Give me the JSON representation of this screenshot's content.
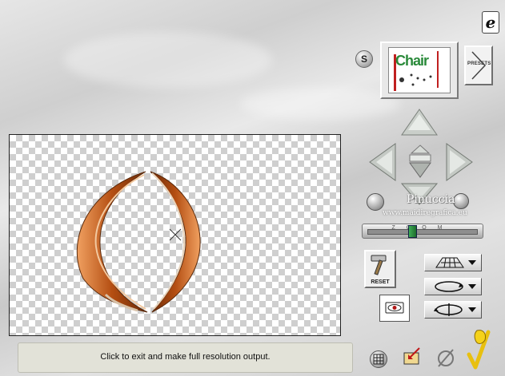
{
  "header": {
    "logo_icon": "e-logo-icon"
  },
  "preview": {
    "s_button_label": "S",
    "thumbnail_title": "Chair",
    "presets_label": "PRESETS"
  },
  "navigation": {
    "up_icon": "arrow-up-icon",
    "down_icon": "arrow-down-icon",
    "left_icon": "arrow-left-icon",
    "right_icon": "arrow-right-icon",
    "center_icon": "center-pyramid-icon"
  },
  "watermark": {
    "name": "Pinuccia",
    "url": "www.maidiregrafica.eu"
  },
  "zoom": {
    "letters": "ZOOM",
    "level": 0.4
  },
  "tools": {
    "reset_label": "RESET",
    "reset_icon": "hammer-icon",
    "perspective_icon": "grid-plane-icon",
    "rotate_icon": "rotate-ellipse-icon",
    "flip_icon": "flip-ellipse-icon",
    "eye_icon": "eye-icon"
  },
  "status": {
    "message": "Click to exit and make full resolution output."
  },
  "footer": {
    "grid_icon": "grid-icon",
    "export_icon": "export-icon",
    "cancel_icon": "no-icon",
    "ok_icon": "checkmark-icon"
  },
  "colors": {
    "accent_green": "#2a8a3a",
    "object_orange": "#c8601e",
    "checker": "#cfcfcf"
  }
}
